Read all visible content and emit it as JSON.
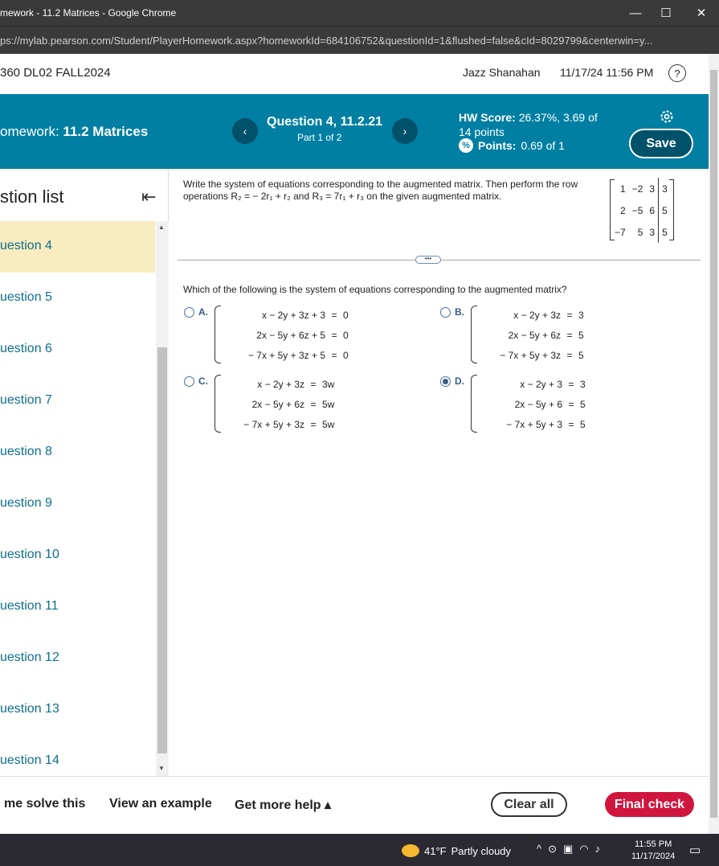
{
  "browser": {
    "window_title": "mework - 11.2 Matrices - Google Chrome",
    "url": "ps://mylab.pearson.com/Student/PlayerHomework.aspx?homeworkId=684106752&questionId=1&flushed=false&cId=8029799&centerwin=y..."
  },
  "course": {
    "name": "360 DL02 FALL2024",
    "user": "Jazz Shanahan",
    "datetime": "11/17/24 11:56 PM"
  },
  "hw": {
    "label": "omework:",
    "name": "11.2 Matrices",
    "question_title": "Question 4, 11.2.21",
    "part": "Part 1 of 2",
    "score_label": "HW Score:",
    "score_value": "26.37%, 3.69 of",
    "score_points": "14 points",
    "points_label": "Points:",
    "points_value": "0.69 of 1",
    "save_label": "Save"
  },
  "sidebar": {
    "heading": "stion list",
    "items": [
      {
        "label": "uestion 4"
      },
      {
        "label": "uestion 5"
      },
      {
        "label": "uestion 6"
      },
      {
        "label": "uestion 7"
      },
      {
        "label": "uestion 8"
      },
      {
        "label": "uestion 9"
      },
      {
        "label": "uestion 10"
      },
      {
        "label": "uestion 11"
      },
      {
        "label": "uestion 12"
      },
      {
        "label": "uestion 13"
      },
      {
        "label": "uestion 14"
      }
    ]
  },
  "question": {
    "instruction": "Write the system of equations corresponding to the augmented matrix. Then perform the row operations R₂ = − 2r₁ + r₂ and R₃ = 7r₁ + r₃ on the given augmented matrix.",
    "matrix": [
      [
        "1",
        "−2",
        "3",
        "3"
      ],
      [
        "2",
        "−5",
        "6",
        "5"
      ],
      [
        "−7",
        "5",
        "3",
        "5"
      ]
    ],
    "prompt": "Which of the following is the system of equations corresponding to the augmented matrix?",
    "choices": [
      {
        "letter": "A.",
        "selected": false,
        "rows": [
          [
            "x − 2y + 3z + 3",
            "=",
            "0"
          ],
          [
            "2x − 5y + 6z + 5",
            "=",
            "0"
          ],
          [
            "− 7x + 5y + 3z + 5",
            "=",
            "0"
          ]
        ]
      },
      {
        "letter": "B.",
        "selected": false,
        "rows": [
          [
            "x − 2y + 3z",
            "=",
            "3"
          ],
          [
            "2x − 5y + 6z",
            "=",
            "5"
          ],
          [
            "− 7x + 5y + 3z",
            "=",
            "5"
          ]
        ]
      },
      {
        "letter": "C.",
        "selected": false,
        "rows": [
          [
            "x − 2y + 3z",
            "=",
            "3w"
          ],
          [
            "2x − 5y + 6z",
            "=",
            "5w"
          ],
          [
            "− 7x + 5y + 3z",
            "=",
            "5w"
          ]
        ]
      },
      {
        "letter": "D.",
        "selected": true,
        "rows": [
          [
            "x − 2y + 3",
            "=",
            "3"
          ],
          [
            "2x − 5y + 6",
            "=",
            "5"
          ],
          [
            "− 7x + 5y + 3",
            "=",
            "5"
          ]
        ]
      }
    ]
  },
  "bottom": {
    "help_solve": "me solve this",
    "view_example": "View an example",
    "more_help": "Get more help ▴",
    "clear_all": "Clear all",
    "final_check": "Final check"
  },
  "taskbar": {
    "temp": "41°F",
    "weather": "Partly cloudy",
    "time": "11:55 PM",
    "date": "11/17/2024"
  },
  "colors": {
    "teal_bar": "#007fa3",
    "final_check": "#d0163e",
    "active_question": "#f8ecc0"
  }
}
